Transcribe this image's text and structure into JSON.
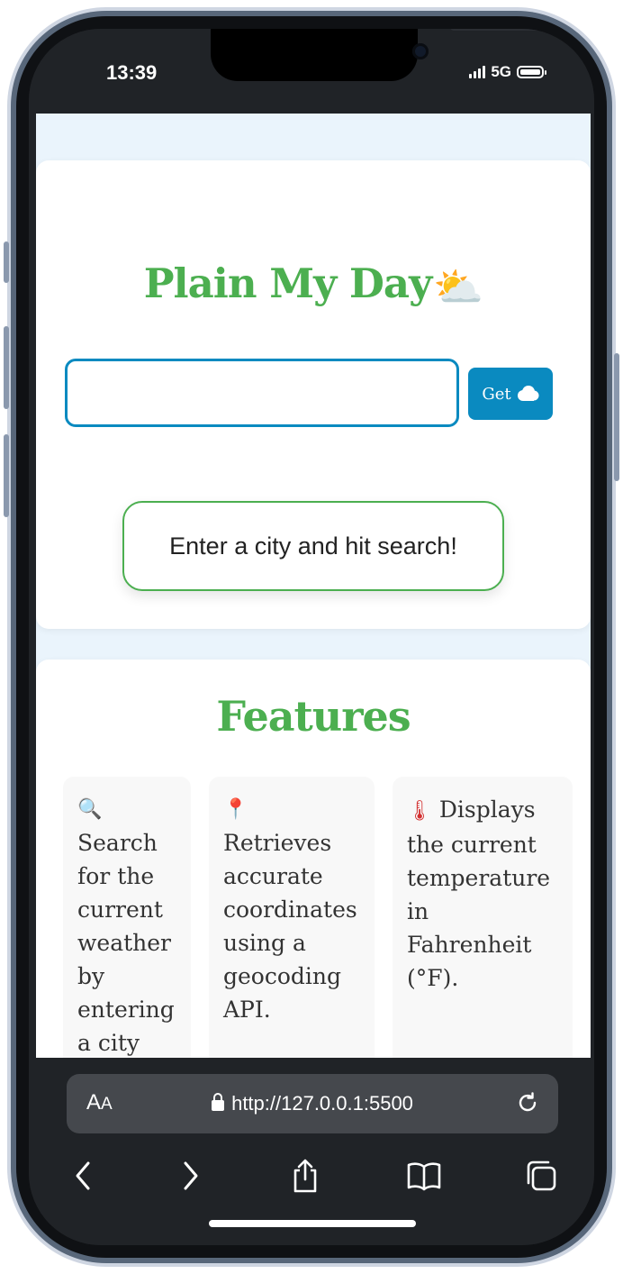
{
  "status_bar": {
    "time": "13:39",
    "network": "5G"
  },
  "page": {
    "title": "Plain My Day",
    "title_emoji": "⛅",
    "search": {
      "value": "",
      "placeholder": ""
    },
    "get_button_label": "Get",
    "message": "Enter a city and hit search!"
  },
  "features": {
    "title": "Features",
    "items": [
      {
        "icon": "🔍",
        "text": "Search for the current weather by entering a city"
      },
      {
        "icon": "📍",
        "text": "Retrieves accurate coordinates using a geocoding API."
      },
      {
        "icon": "🌡",
        "text": "Displays the current temperature in Fahrenheit (°F)."
      }
    ]
  },
  "browser": {
    "aa_label_big": "A",
    "aa_label_small": "A",
    "url": "http://127.0.0.1:5500"
  },
  "colors": {
    "accent_green": "#4caf50",
    "accent_blue": "#0a8ac0",
    "page_background": "#eaf4fc",
    "chrome_dark": "#202327"
  }
}
